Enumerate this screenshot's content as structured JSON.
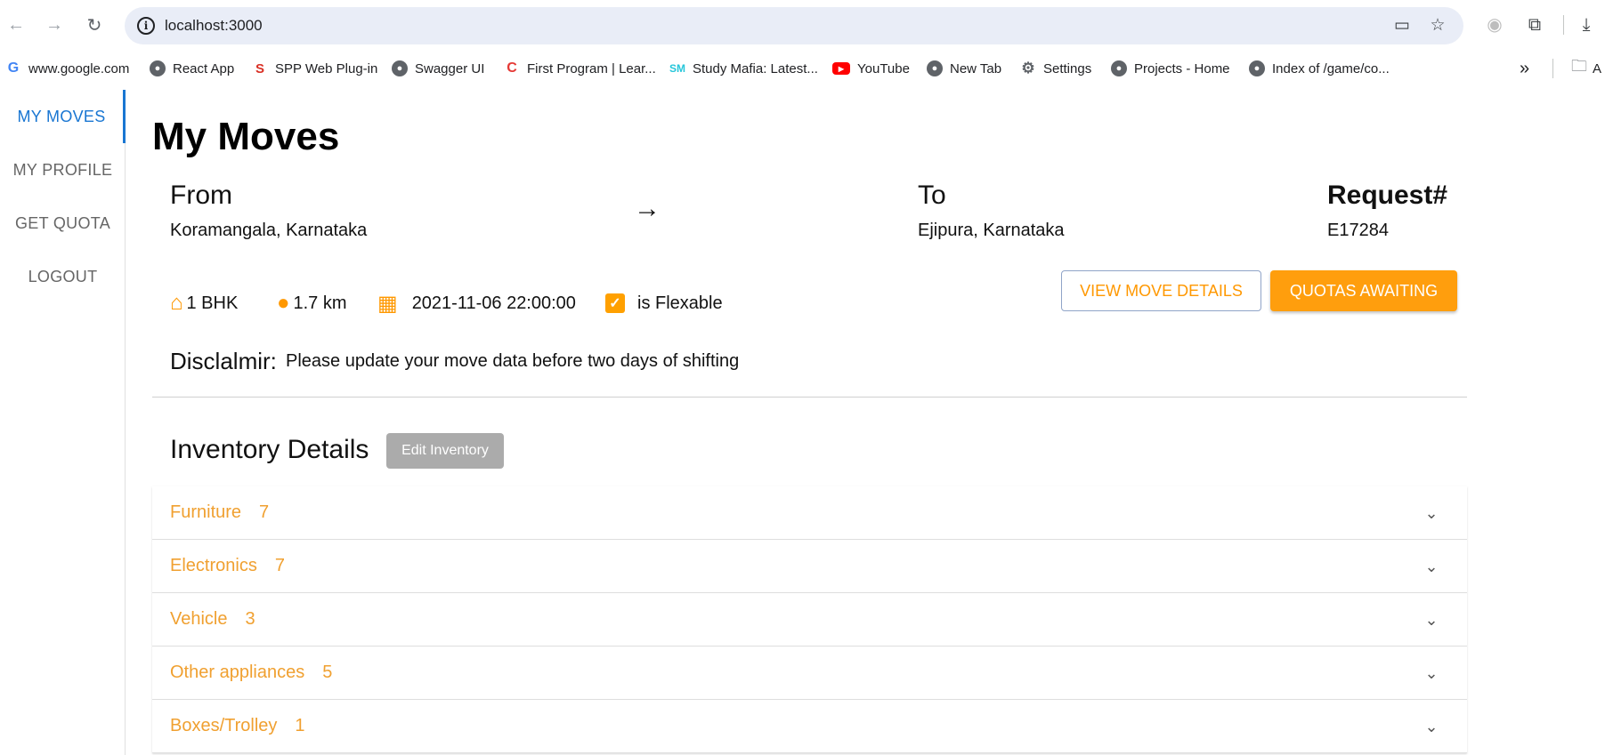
{
  "browser": {
    "url": "localhost:3000",
    "bookmarks": [
      {
        "label": "www.google.com",
        "icon": "google-icon"
      },
      {
        "label": "React App",
        "icon": "globe-icon"
      },
      {
        "label": "SPP Web Plug-in",
        "icon": "spp-icon"
      },
      {
        "label": "Swagger UI",
        "icon": "globe-icon"
      },
      {
        "label": "First Program | Lear...",
        "icon": "c-icon"
      },
      {
        "label": "Study Mafia: Latest...",
        "icon": "sm-icon"
      },
      {
        "label": "YouTube",
        "icon": "youtube-icon"
      },
      {
        "label": "New Tab",
        "icon": "globe-icon"
      },
      {
        "label": "Settings",
        "icon": "gear-icon"
      },
      {
        "label": "Projects - Home",
        "icon": "globe-icon"
      },
      {
        "label": "Index of /game/co...",
        "icon": "globe-icon"
      }
    ],
    "overflow_label": "»",
    "folder_label": "A"
  },
  "sidebar": {
    "items": [
      {
        "label": "MY MOVES",
        "active": true
      },
      {
        "label": "MY PROFILE",
        "active": false
      },
      {
        "label": "GET QUOTA",
        "active": false
      },
      {
        "label": "LOGOUT",
        "active": false
      }
    ]
  },
  "page": {
    "title": "My Moves",
    "from_label": "From",
    "from_value": "Koramangala, Karnataka",
    "to_label": "To",
    "to_value": "Ejipura, Karnataka",
    "request_label": "Request#",
    "request_value": "E17284",
    "house_type": "1 BHK",
    "distance": "1.7 km",
    "datetime": "2021-11-06 22:00:00",
    "flexible_label": "is Flexable",
    "view_details_button": "VIEW MOVE DETAILS",
    "quotas_button": "QUOTAS AWAITING",
    "disclaimer_label": "Disclalmir:",
    "disclaimer_text": "Please update your move data before two days of shifting",
    "inventory_title": "Inventory Details",
    "edit_inventory_button": "Edit Inventory",
    "inventory": [
      {
        "name": "Furniture",
        "count": "7"
      },
      {
        "name": "Electronics",
        "count": "7"
      },
      {
        "name": "Vehicle",
        "count": "3"
      },
      {
        "name": "Other appliances",
        "count": "5"
      },
      {
        "name": "Boxes/Trolley",
        "count": "1"
      }
    ]
  },
  "colors": {
    "accent": "#ff9800",
    "link": "#1976d2"
  }
}
